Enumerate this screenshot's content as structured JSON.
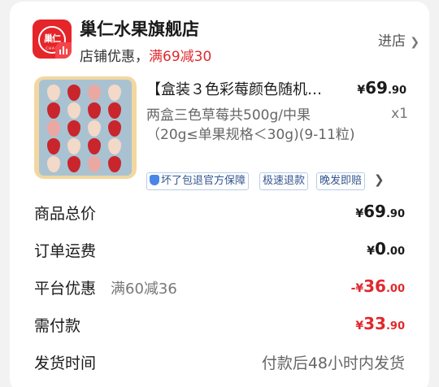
{
  "shop": {
    "logo_mark": "巢仁",
    "logo_text": "CHAO",
    "name": "巢仁水果旗舰店",
    "promo_label": "店铺优惠，",
    "promo_value": "满69减30",
    "enter_label": "进店",
    "accent_color": "#e0292e"
  },
  "product": {
    "title": "【盒装３色彩莓颜色随机…",
    "spec": "两盒三色草莓共500g/中果（20g≤单果规格＜30g)(9-11粒)",
    "price_symbol": "¥",
    "price_int": "69",
    "price_dec": ".90",
    "quantity": "x1",
    "tags": [
      "坏了包退官方保障",
      "极速退款",
      "晚发即赔"
    ]
  },
  "summary": {
    "total": {
      "label": "商品总价",
      "symbol": "¥",
      "int": "69",
      "dec": ".90"
    },
    "shipping": {
      "label": "订单运费",
      "symbol": "¥",
      "int": "0",
      "dec": ".00"
    },
    "platform": {
      "label": "平台优惠",
      "detail": "满60减36",
      "symbol": "-¥",
      "int": "36",
      "dec": ".00"
    },
    "payable": {
      "label": "需付款",
      "symbol": "¥",
      "int": "33",
      "dec": ".90"
    },
    "delivery": {
      "label": "发货时间",
      "value": "付款后48小时内发货"
    }
  }
}
